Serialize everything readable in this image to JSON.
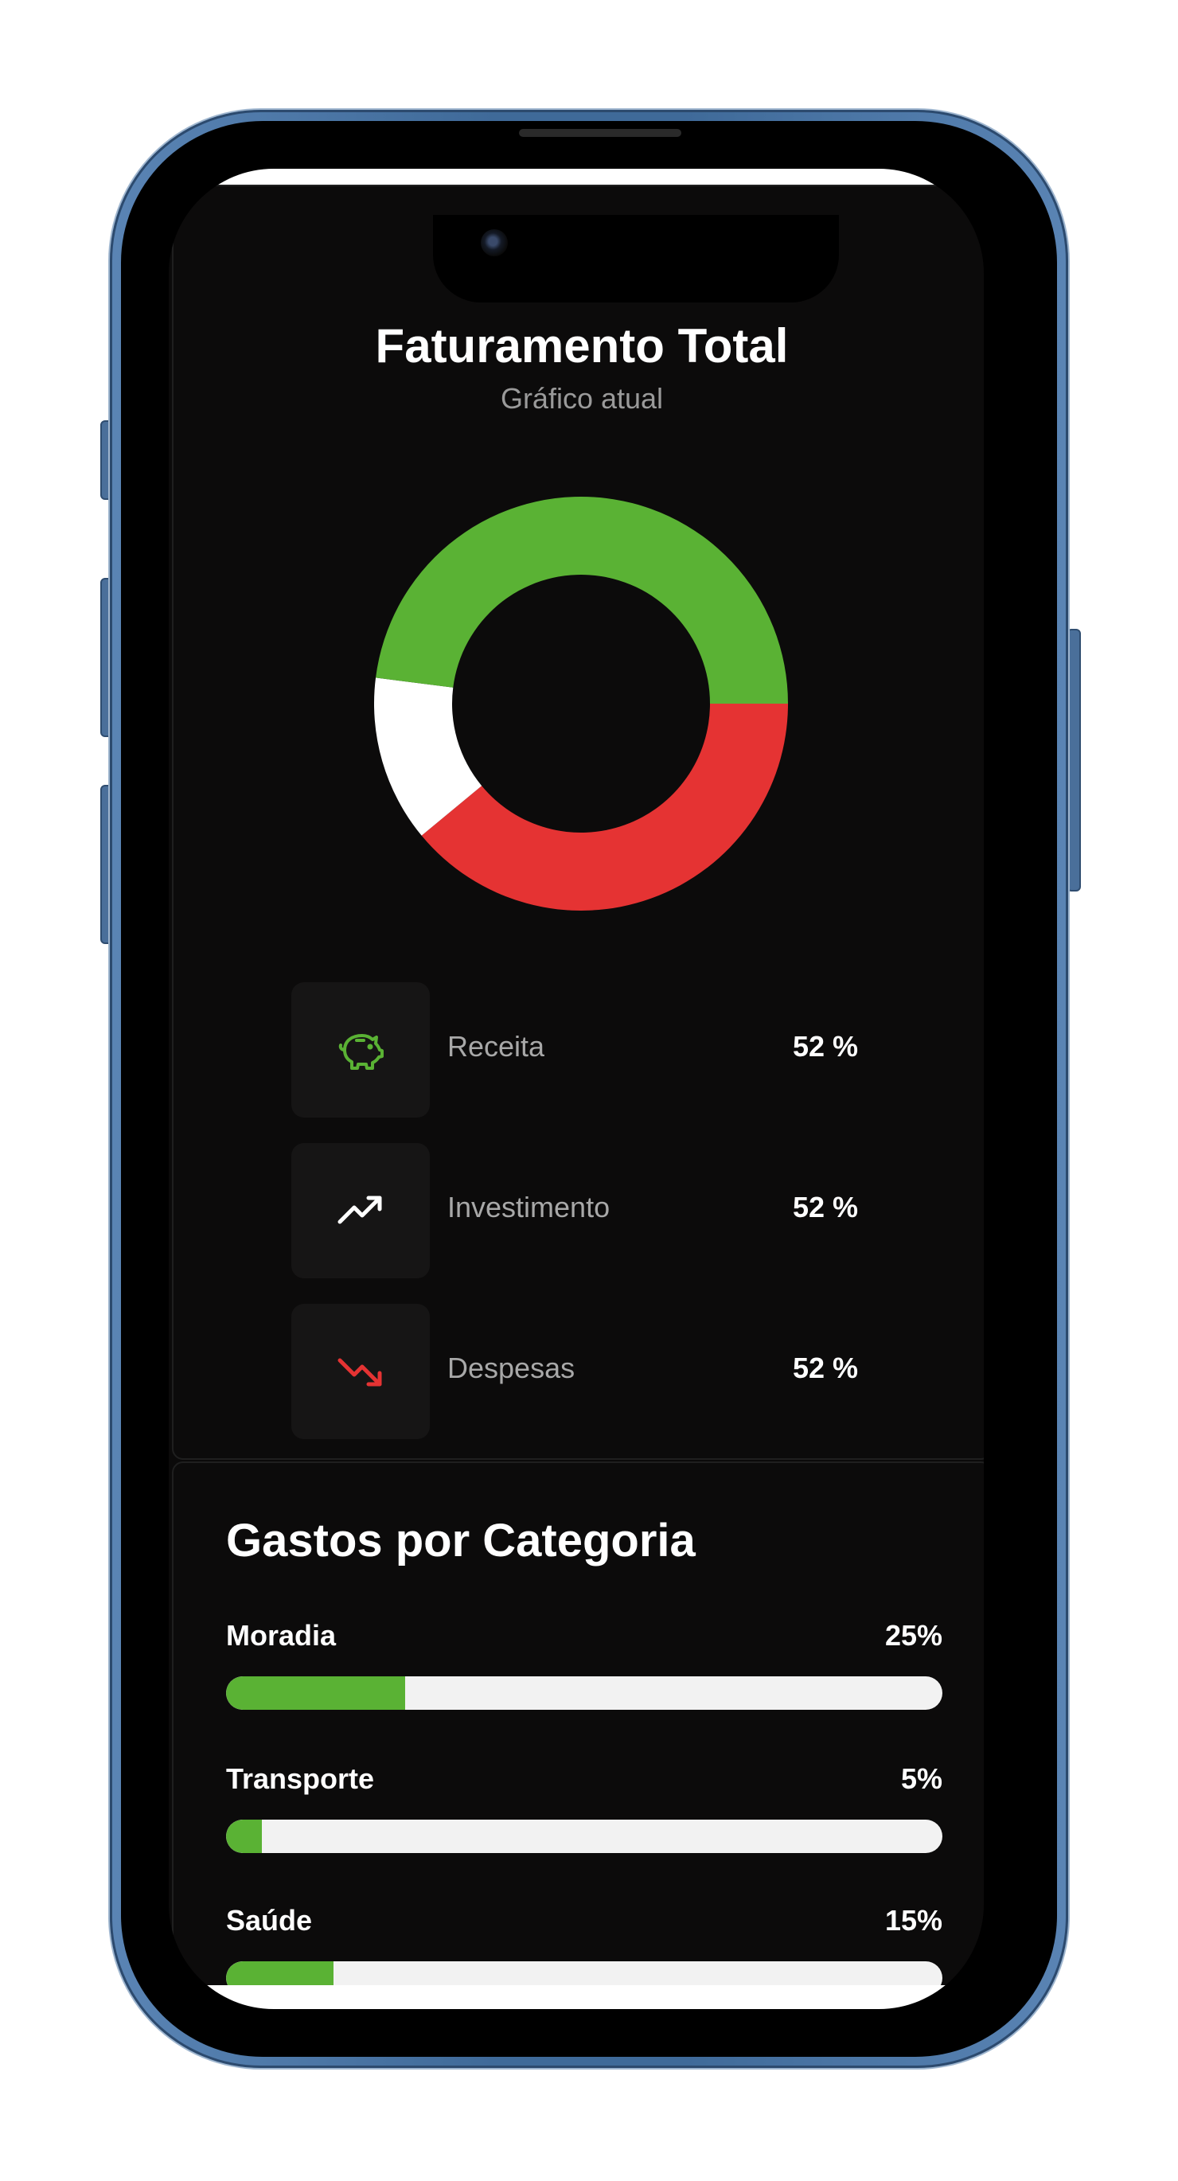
{
  "overview": {
    "title": "Faturamento Total",
    "subtitle": "Gráfico atual"
  },
  "chart_data": {
    "type": "pie",
    "variant": "donut",
    "slices": [
      {
        "label": "Receita",
        "fraction": 0.48,
        "color": "#5ab234"
      },
      {
        "label": "Despesas",
        "fraction": 0.39,
        "color": "#e53333"
      },
      {
        "label": "Investimento",
        "fraction": 0.13,
        "color": "#ffffff"
      }
    ]
  },
  "legend": [
    {
      "label": "Receita",
      "value": "52 %",
      "icon": "piggy-bank-icon",
      "color": "#5ab234"
    },
    {
      "label": "Investimento",
      "value": "52 %",
      "icon": "trending-up-icon",
      "color": "#ffffff"
    },
    {
      "label": "Despesas",
      "value": "52 %",
      "icon": "trending-down-icon",
      "color": "#e53333"
    }
  ],
  "categories": {
    "title": "Gastos por Categoria",
    "items": [
      {
        "name": "Moradia",
        "percent_label": "25%",
        "fill": 0.25
      },
      {
        "name": "Transporte",
        "percent_label": "5%",
        "fill": 0.05
      },
      {
        "name": "Saúde",
        "percent_label": "15%",
        "fill": 0.15
      }
    ]
  },
  "colors": {
    "accent_green": "#5ab234",
    "accent_red": "#e53333",
    "background": "#0b0a0a",
    "track": "#f2f2f2"
  }
}
